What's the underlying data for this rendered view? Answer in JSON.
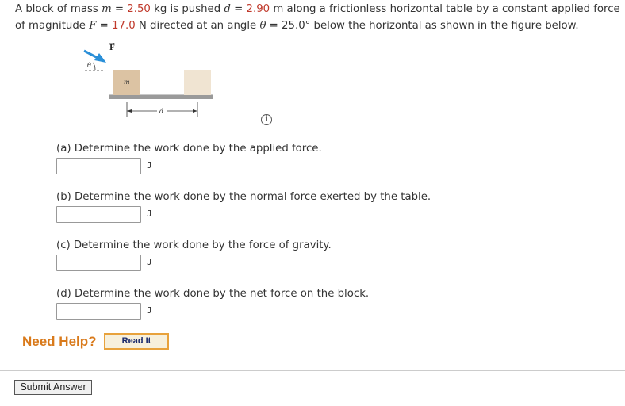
{
  "problem": {
    "t1": "A block of mass ",
    "m_var": "m",
    "t2": " = ",
    "mass": "2.50",
    "t3": " kg is pushed ",
    "d_var": "d",
    "t4": " = ",
    "distance": "2.90",
    "t5": " m along a frictionless horizontal table by a constant applied force of magnitude ",
    "F_var": "F",
    "t6": " = ",
    "force": "17.0",
    "t7": " N directed at an angle ",
    "theta_var": "θ",
    "t8": " = 25.0° below the horizontal as shown in the figure below."
  },
  "figure": {
    "force_label": "F",
    "angle_label": "θ",
    "mass_label": "m",
    "distance_label": "d"
  },
  "info_icon": "i",
  "parts": [
    {
      "question": "(a) Determine the work done by the applied force.",
      "value": "",
      "unit": "J"
    },
    {
      "question": "(b) Determine the work done by the normal force exerted by the table.",
      "value": "",
      "unit": "J"
    },
    {
      "question": "(c) Determine the work done by the force of gravity.",
      "value": "",
      "unit": "J"
    },
    {
      "question": "(d) Determine the work done by the net force on the block.",
      "value": "",
      "unit": "J"
    }
  ],
  "help": {
    "label": "Need Help?",
    "read_it": "Read It"
  },
  "submit_label": "Submit Answer"
}
